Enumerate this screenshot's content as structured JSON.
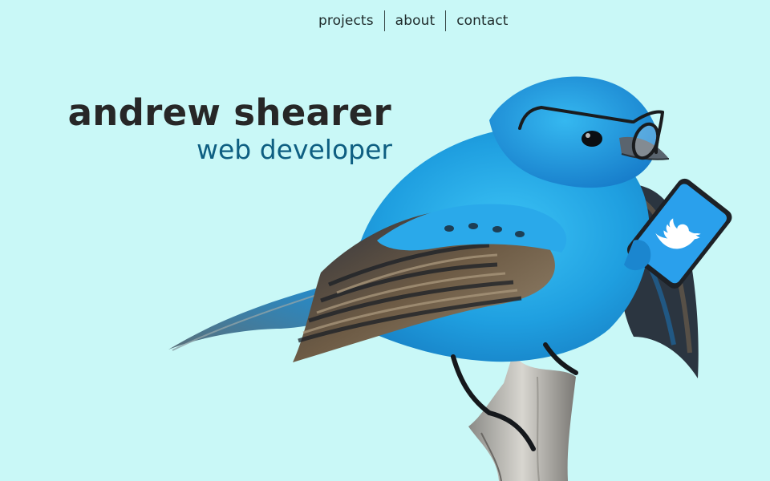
{
  "nav": {
    "items": [
      {
        "label": "projects"
      },
      {
        "label": "about"
      },
      {
        "label": "contact"
      }
    ]
  },
  "hero": {
    "name": "andrew shearer",
    "role": "web developer"
  },
  "illustration": {
    "subject": "bird-icon",
    "accessories": [
      "glasses-icon",
      "phone-icon",
      "twitter-bird-icon"
    ],
    "colors": {
      "background": "#c9f8f7",
      "bird_blue": "#1fa3e6",
      "wing_brown": "#6e5a43",
      "phone_screen": "#2aa0ec",
      "name_text": "#272727",
      "role_text": "#0e5f82"
    }
  }
}
